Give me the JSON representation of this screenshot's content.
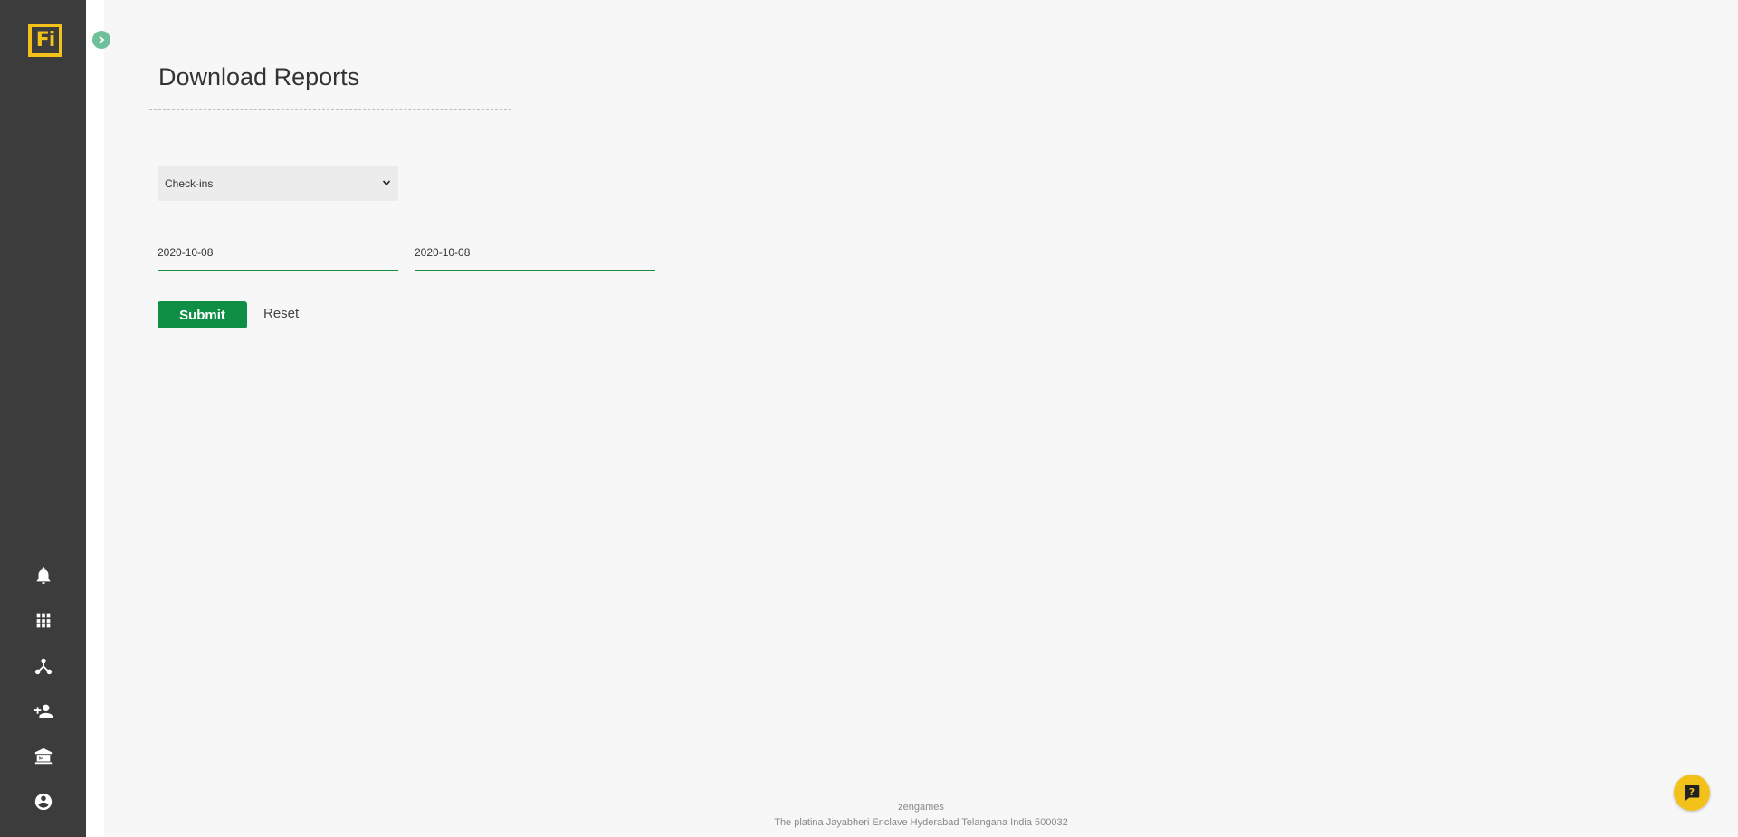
{
  "app": {
    "logo_text": "Fi",
    "brand_color": "#f2c21a",
    "sidebar_color": "#3c3c3c",
    "accent_green": "#0f8f46"
  },
  "sidebar": {
    "icons": [
      {
        "name": "bell-icon"
      },
      {
        "name": "grid-apps-icon"
      },
      {
        "name": "hierarchy-icon"
      },
      {
        "name": "add-user-icon"
      },
      {
        "name": "bank-icon"
      },
      {
        "name": "account-circle-icon"
      }
    ]
  },
  "page": {
    "title": "Download Reports"
  },
  "form": {
    "report_type": "Check-ins",
    "date_from": "2020-10-08",
    "date_to": "2020-10-08",
    "submit_label": "Submit",
    "reset_label": "Reset"
  },
  "footer": {
    "company": "zengames",
    "address": "The platina Jayabheri Enclave Hyderabad Telangana India 500032"
  }
}
